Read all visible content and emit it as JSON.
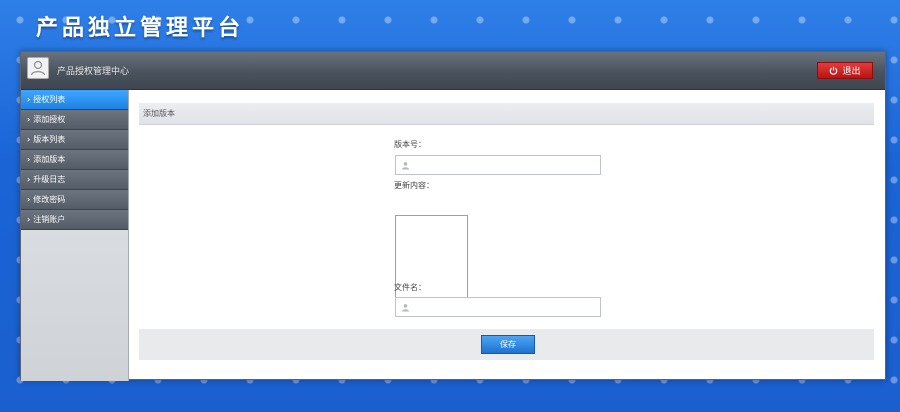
{
  "header": {
    "title": "产品独立管理平台"
  },
  "topbar": {
    "subtitle": "产品授权管理中心",
    "logout_label": "退出"
  },
  "sidebar": {
    "items": [
      {
        "label": "授权列表",
        "active": true
      },
      {
        "label": "添加授权",
        "active": false
      },
      {
        "label": "版本列表",
        "active": false
      },
      {
        "label": "添加版本",
        "active": false
      },
      {
        "label": "升级日志",
        "active": false
      },
      {
        "label": "修改密码",
        "active": false
      },
      {
        "label": "注销账户",
        "active": false
      }
    ]
  },
  "panel": {
    "title": "添加版本"
  },
  "form": {
    "version_label": "版本号：",
    "version_value": "",
    "content_label": "更新内容：",
    "content_value": "",
    "filename_label": "文件名：",
    "filename_value": "",
    "save_label": "保存"
  },
  "colors": {
    "accent_blue": "#1e82e3",
    "logout_red": "#c91c1c",
    "topbar_gray": "#4a525d"
  }
}
